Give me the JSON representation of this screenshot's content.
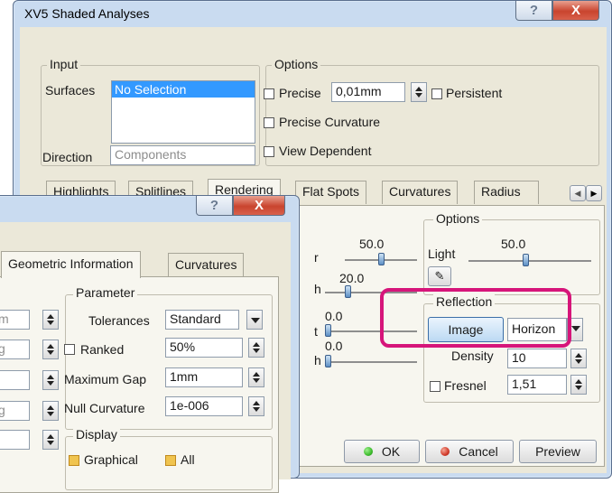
{
  "main_window": {
    "title": "XV5 Shaded Analyses",
    "help_glyph": "?",
    "close_glyph": "X",
    "input": {
      "legend": "Input",
      "surfaces_label": "Surfaces",
      "surfaces_selected": "No Selection",
      "direction_label": "Direction",
      "direction_placeholder": "Components"
    },
    "options": {
      "legend": "Options",
      "precise_label": "Precise",
      "precise_value": "0,01mm",
      "persistent_label": "Persistent",
      "precise_curvature_label": "Precise Curvature",
      "view_dependent_label": "View Dependent"
    },
    "tabs": [
      "Highlights",
      "Splitlines",
      "Rendering",
      "Flat Spots",
      "Curvatures",
      "Radius"
    ],
    "rendering": {
      "sliders": [
        {
          "label_tail": "r",
          "value": "50.0",
          "level": 0.5
        },
        {
          "label_tail": "h",
          "value": "20.0",
          "level": 0.2
        },
        {
          "label_tail": "t",
          "value": "0.0",
          "level": 0.0
        },
        {
          "label_tail": "h",
          "value": "0.0",
          "level": 0.0
        }
      ],
      "options_legend": "Options",
      "light_label": "Light",
      "light_value": "50.0",
      "light_level": 0.5,
      "reflection_legend": "Reflection",
      "image_button": "Image",
      "mode_value": "Horizon",
      "density_label": "Density",
      "density_value": "10",
      "fresnel_label": "Fresnel",
      "fresnel_value": "1,51"
    },
    "buttons": {
      "ok": "OK",
      "cancel": "Cancel",
      "preview": "Preview"
    }
  },
  "second_window": {
    "help_glyph": "?",
    "close_glyph": "X",
    "tabs": [
      "Geometric Information",
      "Curvatures"
    ],
    "left_fields": [
      "m",
      "g",
      "",
      "g",
      ""
    ],
    "parameter": {
      "legend": "Parameter",
      "tolerances_label": "Tolerances",
      "tolerances_value": "Standard",
      "ranked_label": "Ranked",
      "ranked_value": "50%",
      "max_gap_label": "Maximum Gap",
      "max_gap_value": "1mm",
      "null_curvature_label": "Null Curvature",
      "null_curvature_value": "1e-006"
    },
    "display": {
      "legend": "Display",
      "graphical_label": "Graphical",
      "all_label": "All"
    }
  },
  "colors": {
    "highlight_box": "#d6157a",
    "ok_dot": "#3dbb2d",
    "cancel_dot": "#d23a2a",
    "selection": "#3399ff"
  }
}
